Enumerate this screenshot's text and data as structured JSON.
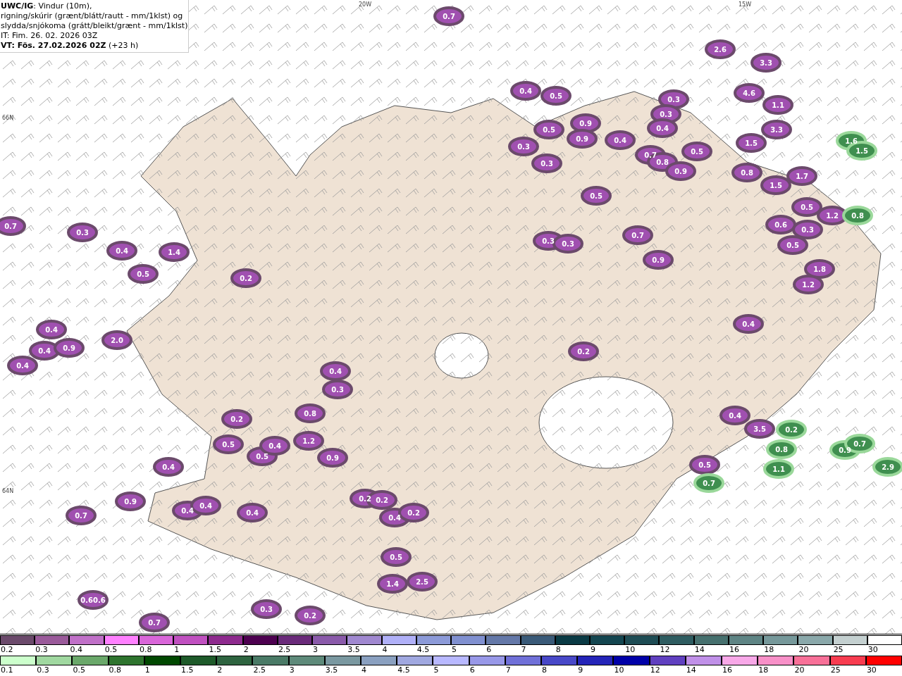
{
  "header": {
    "lines": [
      "**UWC/IG**: Vindur (10m),",
      "rigning/skúrir (grænt/blátt/rautt - mm/1klst) og",
      "slydda/snjókoma (grátt/bleikt/grænt - mm/1klst)",
      "IT: Fim. 26. 02. 2026 03Z",
      "**VT: Fös. 27.02.2026 02Z** (+23 h)"
    ]
  },
  "map": {
    "grid_labels": [
      "20W",
      "15W",
      "66N",
      "64N"
    ],
    "labels": [
      {
        "text": "0.7",
        "kind": "snow"
      },
      {
        "text": "2.6",
        "kind": "snow"
      },
      {
        "text": "3.3",
        "kind": "snow"
      },
      {
        "text": "4.6",
        "kind": "snow"
      },
      {
        "text": "1.1",
        "kind": "snow"
      },
      {
        "text": "3.3",
        "kind": "snow"
      },
      {
        "text": "1.5",
        "kind": "snow"
      },
      {
        "text": "0.4",
        "kind": "snow"
      },
      {
        "text": "0.5",
        "kind": "snow"
      },
      {
        "text": "0.3",
        "kind": "snow"
      },
      {
        "text": "0.3",
        "kind": "snow"
      },
      {
        "text": "0.4",
        "kind": "snow"
      },
      {
        "text": "0.9",
        "kind": "snow"
      },
      {
        "text": "0.5",
        "kind": "snow"
      },
      {
        "text": "0.9",
        "kind": "snow"
      },
      {
        "text": "0.4",
        "kind": "snow"
      },
      {
        "text": "0.5",
        "kind": "snow"
      },
      {
        "text": "0.7",
        "kind": "snow"
      },
      {
        "text": "0.8",
        "kind": "snow"
      },
      {
        "text": "0.9",
        "kind": "snow"
      },
      {
        "text": "0.3",
        "kind": "snow"
      },
      {
        "text": "0.3",
        "kind": "snow"
      },
      {
        "text": "0.8",
        "kind": "snow"
      },
      {
        "text": "1.7",
        "kind": "snow"
      },
      {
        "text": "1.5",
        "kind": "snow"
      },
      {
        "text": "0.5",
        "kind": "snow"
      },
      {
        "text": "1.6",
        "kind": "rain"
      },
      {
        "text": "1.5",
        "kind": "rain"
      },
      {
        "text": "0.5",
        "kind": "snow"
      },
      {
        "text": "1.2",
        "kind": "snow"
      },
      {
        "text": "0.8",
        "kind": "rain"
      },
      {
        "text": "0.6",
        "kind": "snow"
      },
      {
        "text": "0.3",
        "kind": "snow"
      },
      {
        "text": "0.5",
        "kind": "snow"
      },
      {
        "text": "1.8",
        "kind": "snow"
      },
      {
        "text": "1.2",
        "kind": "snow"
      },
      {
        "text": "0.7",
        "kind": "snow"
      },
      {
        "text": "0.9",
        "kind": "snow"
      },
      {
        "text": "0.3",
        "kind": "snow"
      },
      {
        "text": "0.3",
        "kind": "snow"
      },
      {
        "text": "0.4",
        "kind": "snow"
      },
      {
        "text": "0.2",
        "kind": "snow"
      },
      {
        "text": "0.7",
        "kind": "snow"
      },
      {
        "text": "0.3",
        "kind": "snow"
      },
      {
        "text": "0.4",
        "kind": "snow"
      },
      {
        "text": "1.4",
        "kind": "snow"
      },
      {
        "text": "0.5",
        "kind": "snow"
      },
      {
        "text": "0.2",
        "kind": "snow"
      },
      {
        "text": "0.4",
        "kind": "snow"
      },
      {
        "text": "0.4",
        "kind": "snow"
      },
      {
        "text": "0.9",
        "kind": "snow"
      },
      {
        "text": "2.0",
        "kind": "snow"
      },
      {
        "text": "0.4",
        "kind": "snow"
      },
      {
        "text": "0.4",
        "kind": "snow"
      },
      {
        "text": "0.3",
        "kind": "snow"
      },
      {
        "text": "0.8",
        "kind": "snow"
      },
      {
        "text": "0.2",
        "kind": "snow"
      },
      {
        "text": "0.5",
        "kind": "snow"
      },
      {
        "text": "0.4",
        "kind": "snow"
      },
      {
        "text": "1.2",
        "kind": "snow"
      },
      {
        "text": "0.5",
        "kind": "snow"
      },
      {
        "text": "0.9",
        "kind": "snow"
      },
      {
        "text": "0.4",
        "kind": "snow"
      },
      {
        "text": "0.9",
        "kind": "snow"
      },
      {
        "text": "0.7",
        "kind": "snow"
      },
      {
        "text": "0.4",
        "kind": "snow"
      },
      {
        "text": "0.4",
        "kind": "snow"
      },
      {
        "text": "0.4",
        "kind": "snow"
      },
      {
        "text": "0.2",
        "kind": "snow"
      },
      {
        "text": "0.2",
        "kind": "snow"
      },
      {
        "text": "0.4",
        "kind": "snow"
      },
      {
        "text": "0.2",
        "kind": "snow"
      },
      {
        "text": "0.5",
        "kind": "snow"
      },
      {
        "text": "1.4",
        "kind": "snow"
      },
      {
        "text": "2.5",
        "kind": "snow"
      },
      {
        "text": "0.60.6",
        "kind": "snow"
      },
      {
        "text": "0.7",
        "kind": "snow"
      },
      {
        "text": "0.3",
        "kind": "snow"
      },
      {
        "text": "0.2",
        "kind": "snow"
      },
      {
        "text": "0.4",
        "kind": "snow"
      },
      {
        "text": "3.5",
        "kind": "snow"
      },
      {
        "text": "0.2",
        "kind": "rain"
      },
      {
        "text": "0.5",
        "kind": "snow"
      },
      {
        "text": "0.7",
        "kind": "rain"
      },
      {
        "text": "0.8",
        "kind": "rain"
      },
      {
        "text": "1.1",
        "kind": "rain"
      },
      {
        "text": "0.9",
        "kind": "rain"
      },
      {
        "text": "0.7",
        "kind": "rain"
      },
      {
        "text": "2.9",
        "kind": "rain"
      }
    ]
  },
  "legends": [
    {
      "items": [
        {
          "label": "0.2",
          "color": "#6b4a6b"
        },
        {
          "label": "0.3",
          "color": "#9a5a9a"
        },
        {
          "label": "0.4",
          "color": "#c070c8"
        },
        {
          "label": "0.5",
          "color": "#ff80ff"
        },
        {
          "label": "0.8",
          "color": "#d966d9"
        },
        {
          "label": "1",
          "color": "#c050c0"
        },
        {
          "label": "1.5",
          "color": "#8e2a8e"
        },
        {
          "label": "2",
          "color": "#4d0050"
        },
        {
          "label": "2.5",
          "color": "#6a2a7a"
        },
        {
          "label": "3",
          "color": "#8a5aaa"
        },
        {
          "label": "3.5",
          "color": "#a088d0"
        },
        {
          "label": "4",
          "color": "#b0b0f8"
        },
        {
          "label": "4.5",
          "color": "#8c9ad8"
        },
        {
          "label": "5",
          "color": "#8090d0"
        },
        {
          "label": "6",
          "color": "#6478a8"
        },
        {
          "label": "7",
          "color": "#3a5a78"
        },
        {
          "label": "8",
          "color": "#0a3a44"
        },
        {
          "label": "9",
          "color": "#144650"
        },
        {
          "label": "10",
          "color": "#1e4c54"
        },
        {
          "label": "12",
          "color": "#2e5c60"
        },
        {
          "label": "14",
          "color": "#46706e"
        },
        {
          "label": "16",
          "color": "#5e8484"
        },
        {
          "label": "18",
          "color": "#76989a"
        },
        {
          "label": "20",
          "color": "#8aa8aa"
        },
        {
          "label": "25",
          "color": "#c4d0d0"
        },
        {
          "label": "30",
          "color": "#ffffff"
        }
      ]
    },
    {
      "items": [
        {
          "label": "0.1",
          "color": "#ccffcc"
        },
        {
          "label": "0.3",
          "color": "#a0d8a0"
        },
        {
          "label": "0.5",
          "color": "#6aa86a"
        },
        {
          "label": "0.8",
          "color": "#2e742e"
        },
        {
          "label": "1",
          "color": "#004800"
        },
        {
          "label": "1.5",
          "color": "#1e5a2a"
        },
        {
          "label": "2",
          "color": "#2e6440"
        },
        {
          "label": "2.5",
          "color": "#4a7a66"
        },
        {
          "label": "3",
          "color": "#5e8a7a"
        },
        {
          "label": "3.5",
          "color": "#7a98a0"
        },
        {
          "label": "4",
          "color": "#8aa0c0"
        },
        {
          "label": "4.5",
          "color": "#a0a8e0"
        },
        {
          "label": "5",
          "color": "#b8b8ff"
        },
        {
          "label": "6",
          "color": "#9898e8"
        },
        {
          "label": "7",
          "color": "#7070d8"
        },
        {
          "label": "8",
          "color": "#4848c8"
        },
        {
          "label": "9",
          "color": "#2424b8"
        },
        {
          "label": "10",
          "color": "#0000a8"
        },
        {
          "label": "12",
          "color": "#6040c0"
        },
        {
          "label": "14",
          "color": "#c090e8"
        },
        {
          "label": "16",
          "color": "#f8a8e8"
        },
        {
          "label": "18",
          "color": "#f890c8"
        },
        {
          "label": "20",
          "color": "#f87098"
        },
        {
          "label": "25",
          "color": "#f83c50"
        },
        {
          "label": "30",
          "color": "#ff0000"
        }
      ]
    }
  ]
}
